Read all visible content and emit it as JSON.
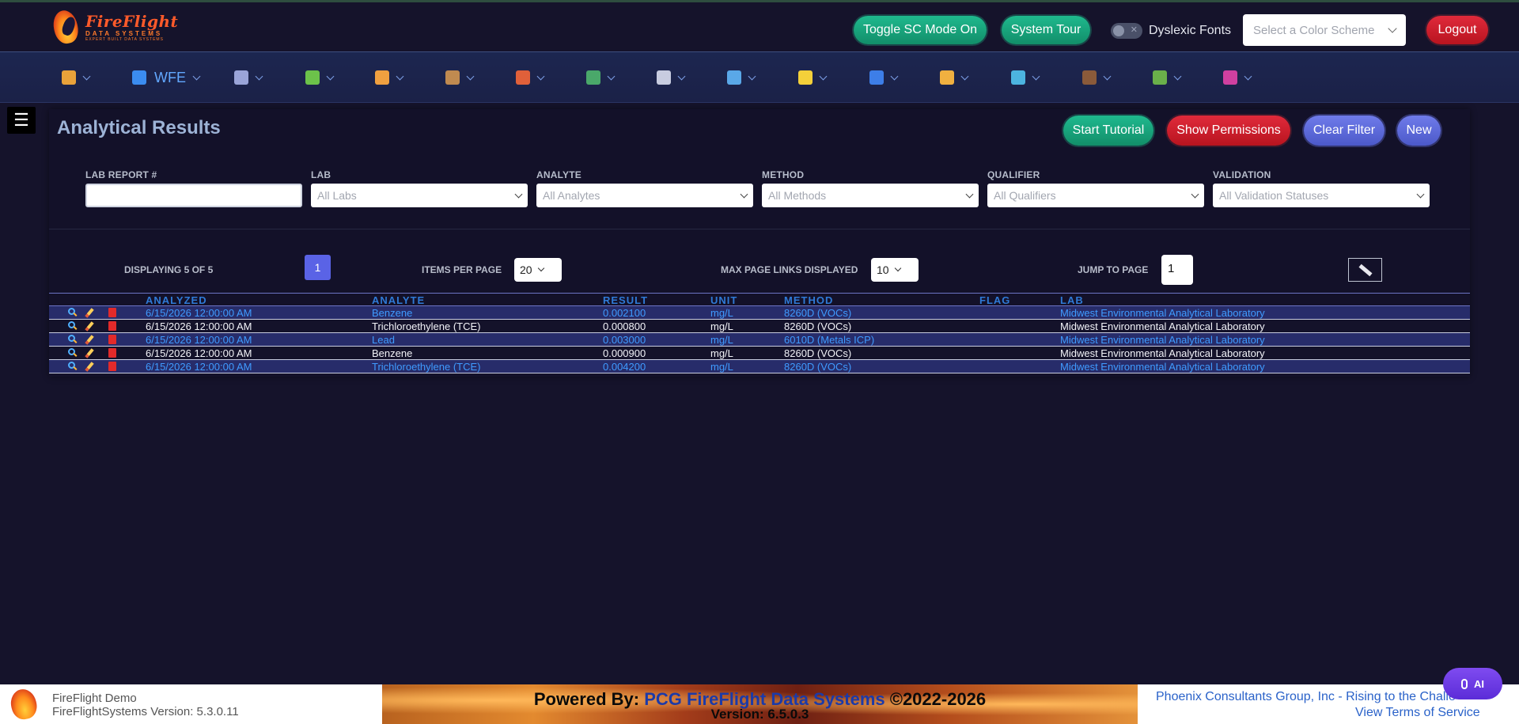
{
  "header": {
    "logo": {
      "line1": "FireFlight",
      "line2": "DATA SYSTEMS",
      "line3": "EXPERT BUILT DATA SYSTEMS"
    },
    "toggle_sc_label": "Toggle SC Mode On",
    "system_tour_label": "System Tour",
    "dyslexic_fonts_label": "Dyslexic Fonts",
    "color_scheme_placeholder": "Select a Color Scheme",
    "logout_label": "Logout"
  },
  "nav": {
    "items": [
      {
        "icon": "home-icon",
        "label": ""
      },
      {
        "icon": "workflow-icon",
        "label": "WFE"
      },
      {
        "icon": "document-icon",
        "label": ""
      },
      {
        "icon": "puzzle-icon",
        "label": ""
      },
      {
        "icon": "truck-icon",
        "label": ""
      },
      {
        "icon": "box-icon",
        "label": ""
      },
      {
        "icon": "brick-wall-icon",
        "label": ""
      },
      {
        "icon": "pin-icon",
        "label": ""
      },
      {
        "icon": "clipboard-icon",
        "label": ""
      },
      {
        "icon": "magnifier-icon",
        "label": ""
      },
      {
        "icon": "lightbulb-icon",
        "label": ""
      },
      {
        "icon": "shield-icon",
        "label": ""
      },
      {
        "icon": "signature-icon",
        "label": ""
      },
      {
        "icon": "colors-icon",
        "label": ""
      },
      {
        "icon": "graduation-icon",
        "label": ""
      },
      {
        "icon": "leaf-icon",
        "label": ""
      },
      {
        "icon": "virus-icon",
        "label": ""
      }
    ]
  },
  "page": {
    "title": "Analytical Results",
    "buttons": {
      "start_tutorial": "Start Tutorial",
      "show_permissions": "Show Permissions",
      "clear_filter": "Clear Filter",
      "new": "New"
    }
  },
  "filters": {
    "lab_report": {
      "label": "LAB REPORT #",
      "value": ""
    },
    "lab": {
      "label": "LAB",
      "placeholder": "All Labs"
    },
    "analyte": {
      "label": "ANALYTE",
      "placeholder": "All Analytes"
    },
    "method": {
      "label": "METHOD",
      "placeholder": "All Methods"
    },
    "qualifier": {
      "label": "QUALIFIER",
      "placeholder": "All Qualifiers"
    },
    "validation": {
      "label": "VALIDATION",
      "placeholder": "All Validation Statuses"
    }
  },
  "pagination": {
    "displaying": "DISPLAYING 5 OF 5",
    "current_page": "1",
    "items_per_page_label": "ITEMS PER PAGE",
    "items_per_page": "20",
    "max_links_label": "MAX PAGE LINKS DISPLAYED",
    "max_links": "10",
    "jump_label": "JUMP TO PAGE",
    "jump_value": "1"
  },
  "table": {
    "columns": [
      "ANALYZED",
      "ANALYTE",
      "RESULT",
      "UNIT",
      "METHOD",
      "FLAG",
      "LAB"
    ],
    "rows": [
      {
        "analyzed": "6/15/2026 12:00:00 AM",
        "analyte": "Benzene",
        "result": "0.002100",
        "unit": "mg/L",
        "method": "8260D (VOCs)",
        "flag": "",
        "lab": "Midwest Environmental Analytical Laboratory"
      },
      {
        "analyzed": "6/15/2026 12:00:00 AM",
        "analyte": "Trichloroethylene (TCE)",
        "result": "0.000800",
        "unit": "mg/L",
        "method": "8260D (VOCs)",
        "flag": "",
        "lab": "Midwest Environmental Analytical Laboratory"
      },
      {
        "analyzed": "6/15/2026 12:00:00 AM",
        "analyte": "Lead",
        "result": "0.003000",
        "unit": "mg/L",
        "method": "6010D (Metals ICP)",
        "flag": "",
        "lab": "Midwest Environmental Analytical Laboratory"
      },
      {
        "analyzed": "6/15/2026 12:00:00 AM",
        "analyte": "Benzene",
        "result": "0.000900",
        "unit": "mg/L",
        "method": "8260D (VOCs)",
        "flag": "",
        "lab": "Midwest Environmental Analytical Laboratory"
      },
      {
        "analyzed": "6/15/2026 12:00:00 AM",
        "analyte": "Trichloroethylene (TCE)",
        "result": "0.004200",
        "unit": "mg/L",
        "method": "8260D (VOCs)",
        "flag": "",
        "lab": "Midwest Environmental Analytical Laboratory"
      }
    ]
  },
  "footer": {
    "app_name": "FireFlight Demo",
    "app_version": "FireFlightSystems Version: 5.3.0.11",
    "powered_prefix": "Powered By: ",
    "powered_company": "PCG FireFlight Data Systems",
    "powered_suffix": " ©2022-2026",
    "banner_version": "Version: 6.5.0.3",
    "company_link": "Phoenix Consultants Group, Inc - Rising to the Challe",
    "terms_link": "View Terms of Service"
  },
  "ai_button_label": "AI"
}
